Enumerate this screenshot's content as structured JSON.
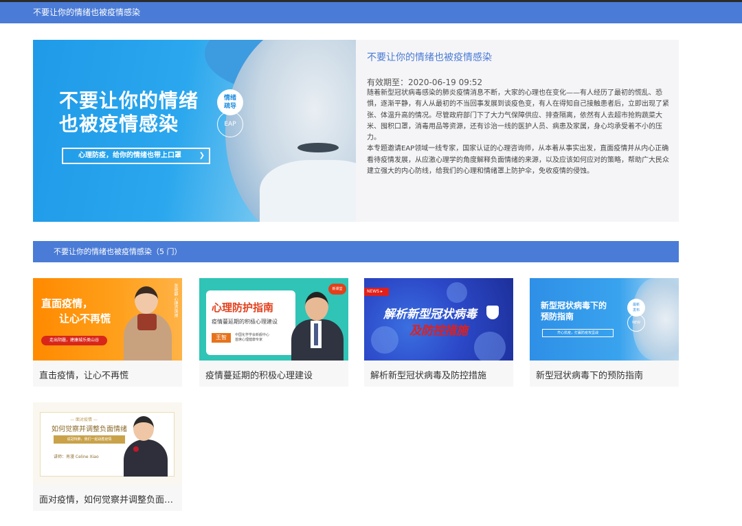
{
  "header": {
    "title": "不要让你的情绪也被疫情感染"
  },
  "hero": {
    "image": {
      "headline_line1": "不要让你的情绪",
      "headline_line2": "也被疫情感染",
      "badge_line1": "情绪",
      "badge_line2": "疏导",
      "badge_eap": "EAP",
      "slogan": "心理防疫，给你的情绪也带上口罩",
      "slogan_arrow": "❯"
    },
    "title": "不要让你的情绪也被疫情感染",
    "valid_label": "有效期至：",
    "valid_value": "2020-06-19 09:52",
    "description_p1": "随着新型冠状病毒感染的肺炎疫情消息不断，大家的心理也在变化——有人经历了最初的慌乱、恐惧，逐渐平静，有人从最初的不当回事发展到谈疫色变，有人在得知自己接触患者后，立即出现了紧张、体温升高的情况。尽管政府部门下了大力气保障供应、排查隔离，依然有人去超市抢购蔬菜大米、囤积口罩，消毒用品等资源，还有诊治一线的医护人员、病患及家属，身心均承受着不小的压力。",
    "description_p2": "本专题邀请EAP领域一线专家，国家认证的心理咨询师，从本着从事实出发，直面疫情并从内心正确看待疫情发展，从应激心理学的角度解释负面情绪的来源，以及应该如何应对的策略，帮助广大民众建立强大的内心防线，给我们的心理和情绪罩上防护伞，免收疫情的侵蚀。"
  },
  "section": {
    "title": "不要让你的情绪也被疫情感染（5 门）"
  },
  "courses": [
    {
      "caption": "直击疫情，让心不再慌",
      "thumb": {
        "line1": "直面疫情，",
        "line2": "让心不再慌",
        "pill": "走出阴霾，建康城乐类山谷",
        "side": "张晓静 心理咨询师"
      }
    },
    {
      "caption": "疫情蔓延期的积极心理建设",
      "thumb": {
        "title": "心理防护指南",
        "subtitle": "疫情蔓延期的积极心理建设",
        "name": "王智",
        "org_line1": "中国化学学会新舰中心",
        "org_line2": "首席心理健康专家",
        "tag": "新课堂"
      }
    },
    {
      "caption": "解析新型冠状病毒及防控措施",
      "thumb": {
        "news": "NEWS ▸",
        "line1": "解析新型冠状病毒",
        "line2": "及防控措施"
      }
    },
    {
      "caption": "新型冠状病毒下的预防指南",
      "thumb": {
        "line1": "新型冠状病毒下的",
        "line2": "预防指南",
        "badge_line1": "最新",
        "badge_line2": "发布",
        "badge_new": "NEW",
        "slogan": "齐心抗疫，打赢防疫攻坚战"
      }
    },
    {
      "caption": "面对疫情，如何觉察并调整负面情绪",
      "thumb": {
        "small": "— 面对疫情 —",
        "title": "如何觉察并调整负面情绪",
        "pill": "说冠特肺，我们一起战胜疫情",
        "by": "讲师：肖漫 Celine Xiao"
      }
    }
  ]
}
